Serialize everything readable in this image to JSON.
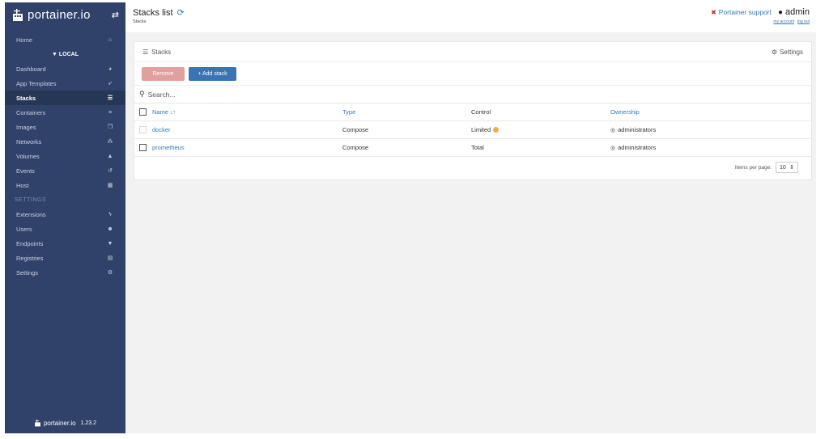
{
  "brand": {
    "name": "portainer.io",
    "version": "1.23.2"
  },
  "sidebar": {
    "home": {
      "label": "Home",
      "icon": "home-icon"
    },
    "endpoint": "▼ LOCAL",
    "items": [
      {
        "label": "Dashboard",
        "icon": "tachometer-icon"
      },
      {
        "label": "App Templates",
        "icon": "rocket-icon"
      },
      {
        "label": "Stacks",
        "icon": "th-list-icon",
        "active": true
      },
      {
        "label": "Containers",
        "icon": "server-icon"
      },
      {
        "label": "Images",
        "icon": "clone-icon"
      },
      {
        "label": "Networks",
        "icon": "sitemap-icon"
      },
      {
        "label": "Volumes",
        "icon": "cubes-icon"
      },
      {
        "label": "Events",
        "icon": "history-icon"
      },
      {
        "label": "Host",
        "icon": "th-icon"
      }
    ],
    "settings_header": "SETTINGS",
    "settings_items": [
      {
        "label": "Extensions",
        "icon": "bolt-icon"
      },
      {
        "label": "Users",
        "icon": "users-icon"
      },
      {
        "label": "Endpoints",
        "icon": "plug-icon"
      },
      {
        "label": "Registries",
        "icon": "database-icon"
      },
      {
        "label": "Settings",
        "icon": "cogs-icon"
      }
    ]
  },
  "header": {
    "title": "Stacks list",
    "breadcrumb": "Stacks",
    "support": "Portainer support",
    "user": "admin",
    "my_account": "my account",
    "log_out": "log out"
  },
  "panel": {
    "title": "Stacks",
    "settings": "Settings",
    "remove": "Remove",
    "add": "+ Add stack",
    "search_placeholder": "Search..."
  },
  "table": {
    "columns": {
      "name": "Name",
      "type": "Type",
      "control": "Control",
      "ownership": "Ownership"
    },
    "rows": [
      {
        "name": "docker",
        "type": "Compose",
        "control": "Limited",
        "ownership": "administrators"
      },
      {
        "name": "prometheus",
        "type": "Compose",
        "control": "Total",
        "ownership": "administrators"
      }
    ]
  },
  "pagination": {
    "label": "Items per page:",
    "value": "10"
  },
  "colors": {
    "sidebar": "#30426a",
    "accent": "#337ab7",
    "remove": "#e0a09e",
    "add": "#3a74b4",
    "warn": "#f0ad4e"
  }
}
